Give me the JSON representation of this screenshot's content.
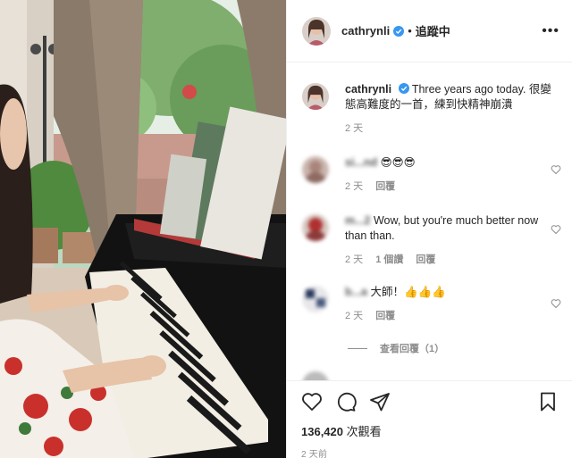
{
  "post": {
    "username": "cathrynli",
    "follow_state": "追蹤中",
    "caption": "Three years ago today. 很變態高難度的一首，練到快精神崩潰",
    "caption_time": "2 天"
  },
  "comments": [
    {
      "username": "si...nd",
      "text": "😎😎😎",
      "time": "2 天",
      "reply_label": "回覆"
    },
    {
      "username": "m...2",
      "text": "Wow, but you're much better now than than.",
      "time": "2 天",
      "likes": "1 個讚",
      "reply_label": "回覆"
    },
    {
      "username": "b...a",
      "text": "大師！👍👍👍",
      "time": "2 天",
      "reply_label": "回覆"
    }
  ],
  "view_replies": "查看回覆（1）",
  "actions": {
    "views_count": "136,420",
    "views_label": "次觀看",
    "posted": "2 天前"
  },
  "icons": [
    "heart-icon",
    "comment-icon",
    "share-icon",
    "bookmark-icon",
    "verified-badge-icon",
    "more-options-icon"
  ],
  "colors": {
    "verified": "#3897f0",
    "meta": "#8e8e8e",
    "text": "#262626"
  }
}
